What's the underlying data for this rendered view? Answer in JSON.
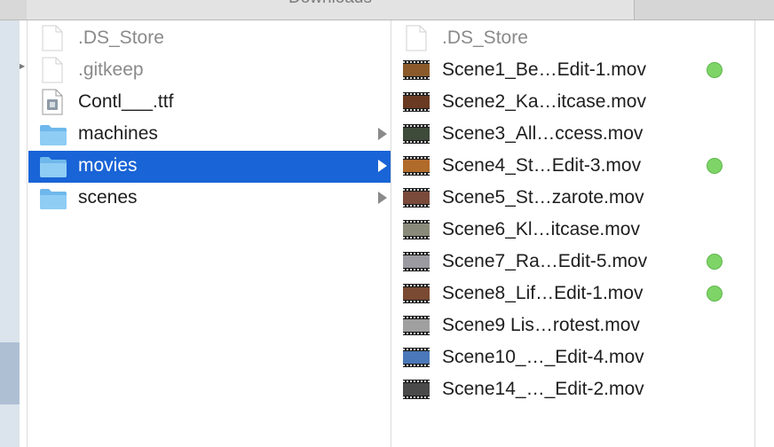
{
  "window": {
    "tab_title": "Downloads"
  },
  "column1": {
    "items": [
      {
        "name": ".DS_Store",
        "kind": "file-dim"
      },
      {
        "name": ".gitkeep",
        "kind": "file-dim"
      },
      {
        "name": "Contl___.ttf",
        "kind": "font"
      },
      {
        "name": "machines",
        "kind": "folder"
      },
      {
        "name": "movies",
        "kind": "folder",
        "selected": true
      },
      {
        "name": "scenes",
        "kind": "folder"
      }
    ]
  },
  "column2": {
    "items": [
      {
        "name": ".DS_Store",
        "kind": "file-dim"
      },
      {
        "name": "Scene1_Be…Edit-1.mov",
        "kind": "movie",
        "tag": "green",
        "thumb_color": "#8a5a2a"
      },
      {
        "name": "Scene2_Ka…itcase.mov",
        "kind": "movie",
        "thumb_color": "#6a3a22"
      },
      {
        "name": "Scene3_All…ccess.mov",
        "kind": "movie",
        "thumb_color": "#3e4a3a"
      },
      {
        "name": "Scene4_St…Edit-3.mov",
        "kind": "movie",
        "tag": "green",
        "thumb_color": "#b06a2a"
      },
      {
        "name": "Scene5_St…zarote.mov",
        "kind": "movie",
        "thumb_color": "#7a4a3a"
      },
      {
        "name": "Scene6_Kl…itcase.mov",
        "kind": "movie",
        "thumb_color": "#8a8a7a"
      },
      {
        "name": "Scene7_Ra…Edit-5.mov",
        "kind": "movie",
        "tag": "green",
        "thumb_color": "#9a9aa0"
      },
      {
        "name": "Scene8_Lif…Edit-1.mov",
        "kind": "movie",
        "tag": "green",
        "thumb_color": "#7a4a32"
      },
      {
        "name": "Scene9 Lis…rotest.mov",
        "kind": "movie",
        "thumb_color": "#a0a0a0"
      },
      {
        "name": "Scene10_…_Edit-4.mov",
        "kind": "movie",
        "thumb_color": "#4a78b8"
      },
      {
        "name": "Scene14_…_Edit-2.mov",
        "kind": "movie",
        "thumb_color": "#4a4a4a"
      }
    ]
  },
  "colors": {
    "selection": "#1964d6",
    "folder": "#74bff0",
    "tag_green": "#7ed467"
  }
}
